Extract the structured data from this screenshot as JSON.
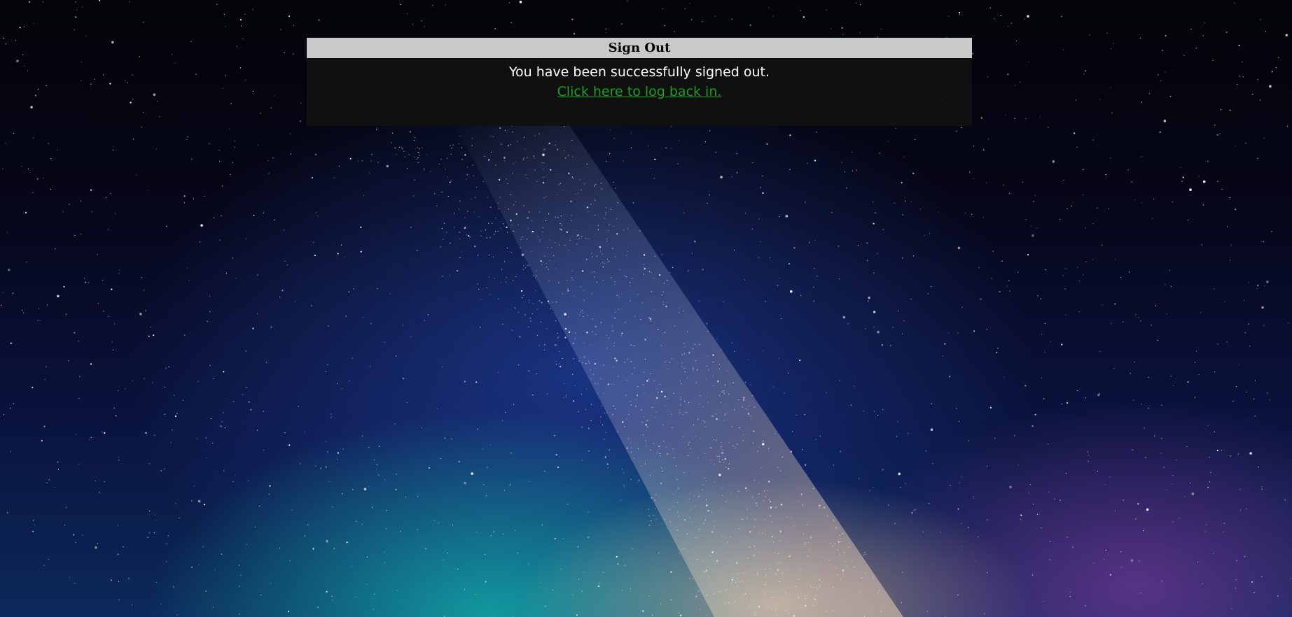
{
  "page": {
    "background": "starry-night-sky"
  },
  "signout_panel": {
    "title": "Sign Out",
    "message": "You have been successfully signed out.",
    "relogin_link_text": "Click here to log back in.",
    "header_color": "#c9c9c9",
    "body_color": "#111111",
    "link_color": "#1e9e22"
  }
}
